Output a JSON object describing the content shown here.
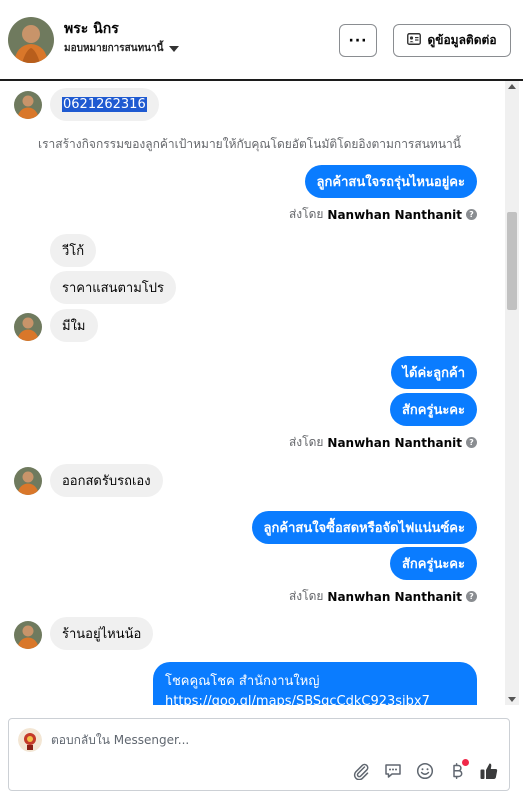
{
  "header": {
    "name": "พระ นิกร",
    "assign_label": "มอบหมายการสนทนานี้",
    "more_label": "···",
    "contact_button_label": "ดูข้อมูลติดต่อ"
  },
  "messages": {
    "phone": "0621262316",
    "system_note": "เราสร้างกิจกรรมของลูกค้าเป้าหมายให้กับคุณโดยอัตโนมัติโดยอิงตามการสนทนานี้",
    "out1": "ลูกค้าสนใจรถรุ่นไหนอยู่คะ",
    "sent_prefix": "ส่งโดย",
    "sender": "Nanwhan Nanthanit",
    "in1": "วีโก้",
    "in2": "ราคาแสนตามโปร",
    "in3": "มีใม",
    "out2": "ได้ค่ะลูกค้า",
    "out3": "สักครู่นะคะ",
    "in4": "ออกสดรับรถเอง",
    "out4": "ลูกค้าสนใจซื้อสดหรือจัดไฟแน่นซ์คะ",
    "out5": "สักครู่นะคะ",
    "in5": "ร้านอยู่ไหนน้อ",
    "out6_line1": "โชคคูณโชค สำนักงานใหญ่",
    "out6_link": "https://goo.gl/maps/SBSqcCdkC923sjbx7"
  },
  "composer": {
    "placeholder": "ตอบกลับใน Messenger..."
  },
  "colors": {
    "accent": "#0a7cff",
    "incoming": "#f0f0f0",
    "selection": "#1f5ad1",
    "notification": "#f02849"
  },
  "icons": [
    "more-icon",
    "contact-card-icon",
    "attach-icon",
    "saved-replies-icon",
    "emoji-icon",
    "payment-icon",
    "like-icon"
  ]
}
